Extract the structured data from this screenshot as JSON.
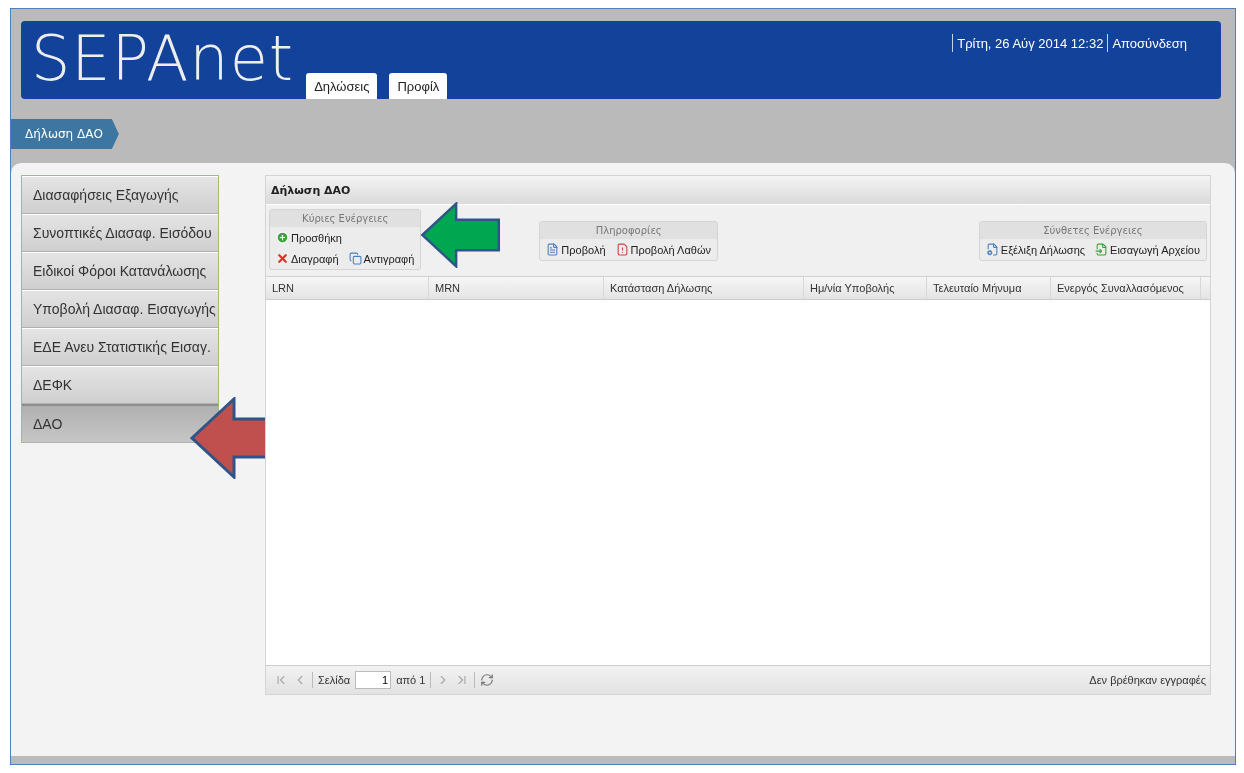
{
  "header": {
    "logo": "SEPAnet",
    "nav_tabs": [
      {
        "label": "Δηλώσεις"
      },
      {
        "label": "Προφίλ"
      }
    ],
    "datetime": "Τρίτη, 26 Αύγ 2014 12:32",
    "logout": "Αποσύνδεση"
  },
  "breadcrumb": [
    "Δήλωση ΔΑΟ"
  ],
  "sidebar": {
    "items": [
      {
        "label": "Διασαφήσεις Εξαγωγής",
        "selected": false
      },
      {
        "label": "Συνοπτικές Διασαφ. Εισόδου",
        "selected": false
      },
      {
        "label": "Ειδικοί Φόροι Κατανάλωσης",
        "selected": false
      },
      {
        "label": "Υποβολή Διασαφ. Εισαγωγής",
        "selected": false
      },
      {
        "label": "ΕΔΕ Ανευ Στατιστικής Εισαγ.",
        "selected": false
      },
      {
        "label": "ΔΕΦΚ",
        "selected": false
      },
      {
        "label": "ΔΑΟ",
        "selected": true
      }
    ]
  },
  "panel": {
    "title": "Δήλωση ΔΑΟ",
    "toolbar_groups": [
      {
        "title": "Κύριες Ενέργειες",
        "rows": [
          [
            {
              "label": "Προσθήκη",
              "kind": "add"
            }
          ],
          [
            {
              "label": "Διαγραφή",
              "kind": "delete"
            },
            {
              "label": "Αντιγραφή",
              "kind": "copy"
            }
          ]
        ]
      },
      {
        "title": "Πληροφορίες",
        "rows": [
          [
            {
              "label": "Προβολή",
              "kind": "view"
            },
            {
              "label": "Προβολή Λαθών",
              "kind": "errors"
            }
          ]
        ]
      },
      {
        "title": "Σύνθετες Ενέργειες",
        "rows": [
          [
            {
              "label": "Εξέλιξη Δήλωσης",
              "kind": "progress"
            },
            {
              "label": "Εισαγωγή Αρχείου",
              "kind": "import"
            }
          ]
        ]
      }
    ],
    "columns": [
      "LRN",
      "MRN",
      "Κατάσταση Δήλωσης",
      "Ημ/νία Υποβολής",
      "Τελευταίο Μήνυμα",
      "Ενεργός Συναλλασόμενος"
    ],
    "pager": {
      "page_label": "Σελίδα",
      "page": "1",
      "of": "από 1",
      "status": "Δεν βρέθηκαν εγγραφές"
    }
  },
  "annotations": [
    {
      "kind": "arrow",
      "color": "#00a650"
    },
    {
      "kind": "arrow",
      "color": "#c0504d"
    }
  ]
}
